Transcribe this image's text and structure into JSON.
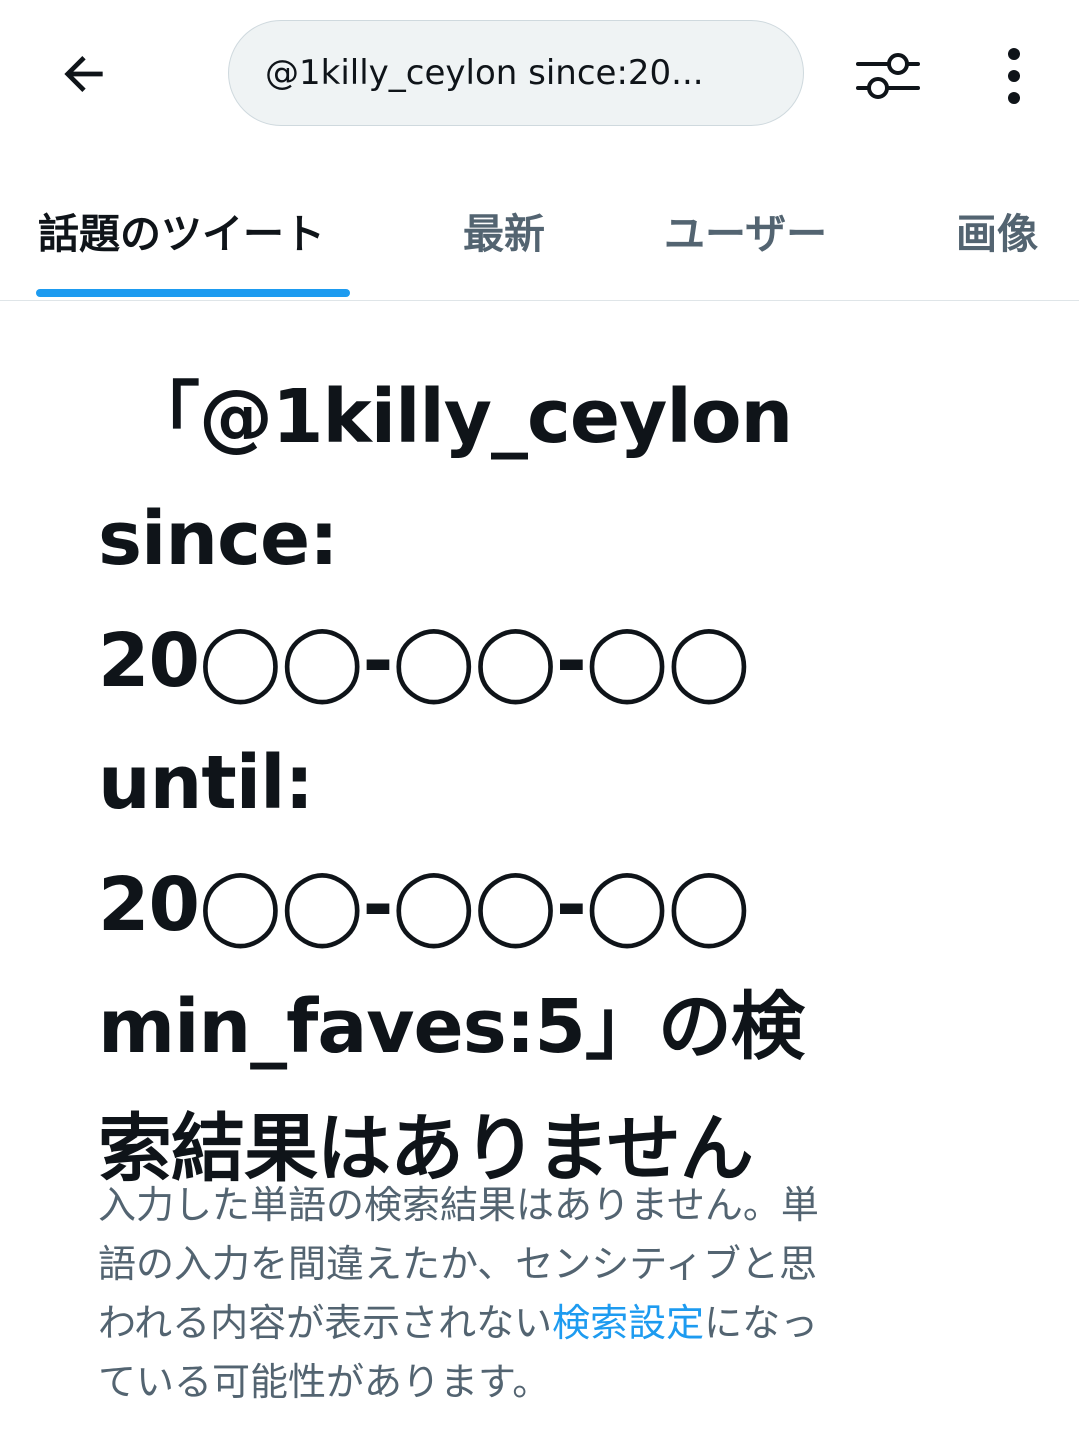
{
  "header": {
    "back_icon": "arrow-left-icon",
    "search_query": "@1killy_ceylon since:20...",
    "filter_icon": "sliders-icon",
    "more_icon": "more-vertical-icon"
  },
  "tabs": [
    {
      "label": "話題のツイート",
      "active": true
    },
    {
      "label": "最新",
      "active": false
    },
    {
      "label": "ユーザー",
      "active": false
    },
    {
      "label": "画像",
      "active": false
    }
  ],
  "empty_state": {
    "title_lines": [
      "「@1killy_ceylon",
      "since:",
      "20◯◯-◯◯-◯◯",
      "until:",
      "20◯◯-◯◯-◯◯",
      "min_faves:5」の検",
      "索結果はありません"
    ],
    "desc_line1": "入力した単語の検索結果はありません。単",
    "desc_line2": "語の入力を間違えたか、センシティブと思",
    "desc_line3_before": "われる内容が表示されない",
    "desc_link": "検索設定",
    "desc_line3_after": "になっ",
    "desc_line4": "ている可能性があります。"
  },
  "colors": {
    "accent": "#1d9bf0",
    "text_primary": "#0f1419",
    "text_secondary": "#536471",
    "pill_bg": "#eff3f4"
  }
}
